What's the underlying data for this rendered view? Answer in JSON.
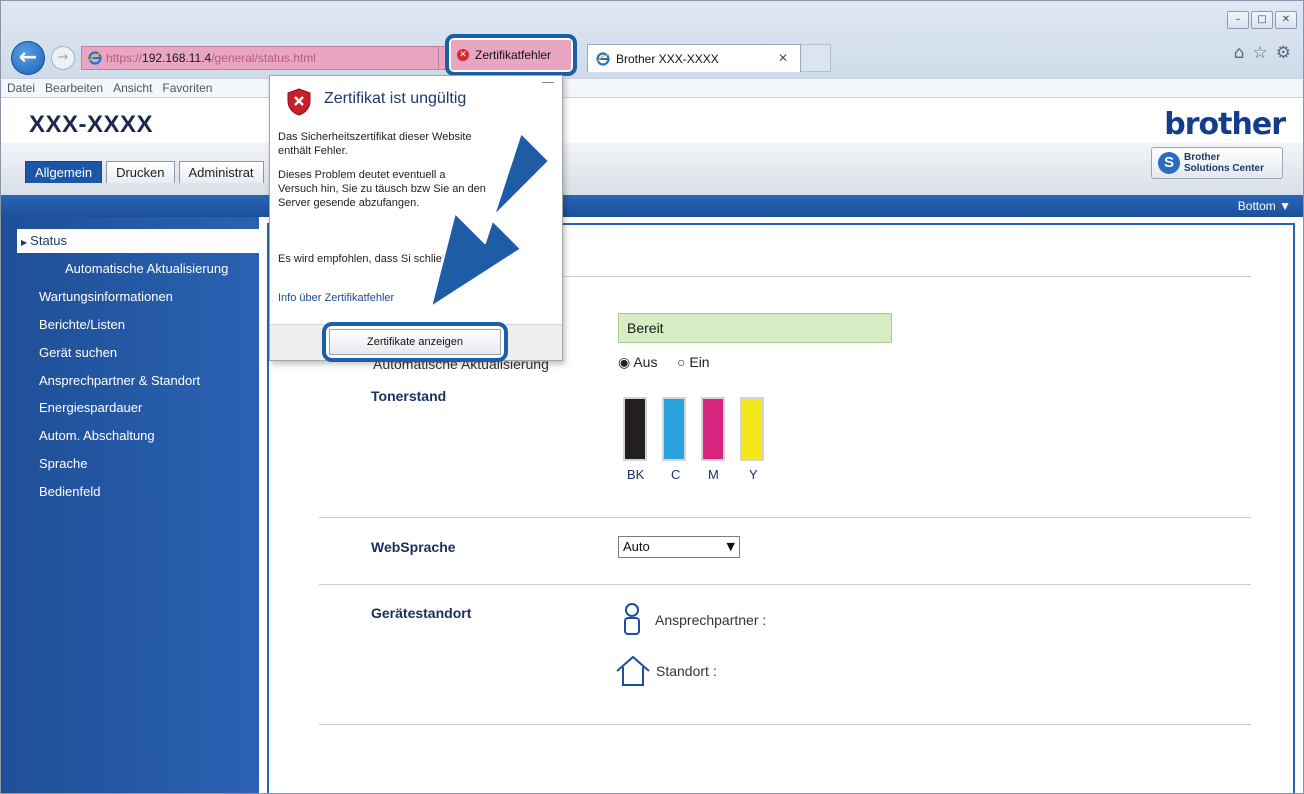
{
  "window": {
    "minimize": "–",
    "maximize": "□",
    "close": "✕"
  },
  "browser": {
    "url_protocol": "https://",
    "url_host": "192.168.11.4",
    "url_path": "/general/status.html",
    "cert_error_label": "Zertifikatfehler",
    "tab_title": "Brother  XXX-XXXX",
    "menu": [
      "Datei",
      "Bearbeiten",
      "Ansicht",
      "Favoriten"
    ]
  },
  "header": {
    "model": "XXX-XXXX",
    "logo": "brother",
    "solutions_line1": "Brother",
    "solutions_line2": "Solutions Center",
    "tabs": [
      "Allgemein",
      "Drucken",
      "Administrat"
    ],
    "bottom_link": "Bottom ▼"
  },
  "sidebar": {
    "active": "Status",
    "items": [
      {
        "label": "Automatische Aktualisierung",
        "sub": true
      },
      {
        "label": "Wartungsinformationen",
        "sub": false
      },
      {
        "label": "Berichte/Listen",
        "sub": false
      },
      {
        "label": "Gerät suchen",
        "sub": false
      },
      {
        "label": "Ansprechpartner & Standort",
        "sub": false
      },
      {
        "label": "Energiespardauer",
        "sub": false
      },
      {
        "label": "Autom. Abschaltung",
        "sub": false
      },
      {
        "label": "Sprache",
        "sub": false
      },
      {
        "label": "Bedienfeld",
        "sub": false
      }
    ]
  },
  "main": {
    "status_value": "Bereit",
    "auto_update_label": "Automatische Aktualisierung",
    "radio_off": "Aus",
    "radio_on": "Ein",
    "toner_label": "Tonerstand",
    "toner": [
      {
        "label": "BK",
        "color": "#231f20",
        "level": 1.0
      },
      {
        "label": "C",
        "color": "#2aa3dc",
        "level": 1.0
      },
      {
        "label": "M",
        "color": "#d6257f",
        "level": 1.0
      },
      {
        "label": "Y",
        "color": "#f2e61a",
        "level": 1.0
      }
    ],
    "websprache_label": "WebSprache",
    "websprache_value": "Auto",
    "location_label": "Gerätestandort",
    "contact_label": "Ansprechpartner :",
    "location_field_label": "Standort :"
  },
  "popup": {
    "title": "Zertifikat ist ungültig",
    "para1": "Das Sicherheitszertifikat dieser Website enthält Fehler.",
    "para2": "Dieses Problem deutet eventuell a Versuch hin, Sie zu täusch bzw Sie an den Server gesende abzufangen.",
    "para3": "Es wird empfohlen, dass Si schließen.",
    "link": "Info über Zertifikatfehler",
    "button": "Zertifikate anzeigen"
  },
  "colors": {
    "accent_blue": "#1d5ea8",
    "error_pink": "#e9a6c1",
    "status_green": "#d7edc6"
  }
}
